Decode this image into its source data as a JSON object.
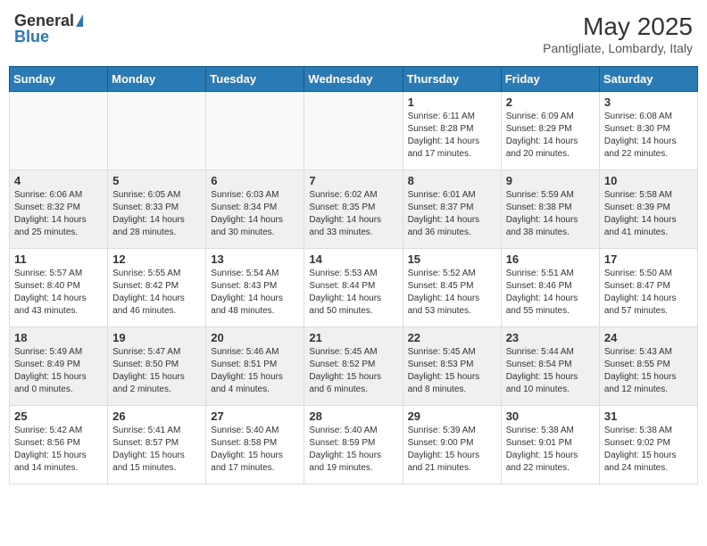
{
  "logo": {
    "general": "General",
    "blue": "Blue"
  },
  "title": "May 2025",
  "subtitle": "Pantigliate, Lombardy, Italy",
  "headers": [
    "Sunday",
    "Monday",
    "Tuesday",
    "Wednesday",
    "Thursday",
    "Friday",
    "Saturday"
  ],
  "weeks": [
    [
      {
        "day": "",
        "info": ""
      },
      {
        "day": "",
        "info": ""
      },
      {
        "day": "",
        "info": ""
      },
      {
        "day": "",
        "info": ""
      },
      {
        "day": "1",
        "info": "Sunrise: 6:11 AM\nSunset: 8:28 PM\nDaylight: 14 hours and 17 minutes."
      },
      {
        "day": "2",
        "info": "Sunrise: 6:09 AM\nSunset: 8:29 PM\nDaylight: 14 hours and 20 minutes."
      },
      {
        "day": "3",
        "info": "Sunrise: 6:08 AM\nSunset: 8:30 PM\nDaylight: 14 hours and 22 minutes."
      }
    ],
    [
      {
        "day": "4",
        "info": "Sunrise: 6:06 AM\nSunset: 8:32 PM\nDaylight: 14 hours and 25 minutes."
      },
      {
        "day": "5",
        "info": "Sunrise: 6:05 AM\nSunset: 8:33 PM\nDaylight: 14 hours and 28 minutes."
      },
      {
        "day": "6",
        "info": "Sunrise: 6:03 AM\nSunset: 8:34 PM\nDaylight: 14 hours and 30 minutes."
      },
      {
        "day": "7",
        "info": "Sunrise: 6:02 AM\nSunset: 8:35 PM\nDaylight: 14 hours and 33 minutes."
      },
      {
        "day": "8",
        "info": "Sunrise: 6:01 AM\nSunset: 8:37 PM\nDaylight: 14 hours and 36 minutes."
      },
      {
        "day": "9",
        "info": "Sunrise: 5:59 AM\nSunset: 8:38 PM\nDaylight: 14 hours and 38 minutes."
      },
      {
        "day": "10",
        "info": "Sunrise: 5:58 AM\nSunset: 8:39 PM\nDaylight: 14 hours and 41 minutes."
      }
    ],
    [
      {
        "day": "11",
        "info": "Sunrise: 5:57 AM\nSunset: 8:40 PM\nDaylight: 14 hours and 43 minutes."
      },
      {
        "day": "12",
        "info": "Sunrise: 5:55 AM\nSunset: 8:42 PM\nDaylight: 14 hours and 46 minutes."
      },
      {
        "day": "13",
        "info": "Sunrise: 5:54 AM\nSunset: 8:43 PM\nDaylight: 14 hours and 48 minutes."
      },
      {
        "day": "14",
        "info": "Sunrise: 5:53 AM\nSunset: 8:44 PM\nDaylight: 14 hours and 50 minutes."
      },
      {
        "day": "15",
        "info": "Sunrise: 5:52 AM\nSunset: 8:45 PM\nDaylight: 14 hours and 53 minutes."
      },
      {
        "day": "16",
        "info": "Sunrise: 5:51 AM\nSunset: 8:46 PM\nDaylight: 14 hours and 55 minutes."
      },
      {
        "day": "17",
        "info": "Sunrise: 5:50 AM\nSunset: 8:47 PM\nDaylight: 14 hours and 57 minutes."
      }
    ],
    [
      {
        "day": "18",
        "info": "Sunrise: 5:49 AM\nSunset: 8:49 PM\nDaylight: 15 hours and 0 minutes."
      },
      {
        "day": "19",
        "info": "Sunrise: 5:47 AM\nSunset: 8:50 PM\nDaylight: 15 hours and 2 minutes."
      },
      {
        "day": "20",
        "info": "Sunrise: 5:46 AM\nSunset: 8:51 PM\nDaylight: 15 hours and 4 minutes."
      },
      {
        "day": "21",
        "info": "Sunrise: 5:45 AM\nSunset: 8:52 PM\nDaylight: 15 hours and 6 minutes."
      },
      {
        "day": "22",
        "info": "Sunrise: 5:45 AM\nSunset: 8:53 PM\nDaylight: 15 hours and 8 minutes."
      },
      {
        "day": "23",
        "info": "Sunrise: 5:44 AM\nSunset: 8:54 PM\nDaylight: 15 hours and 10 minutes."
      },
      {
        "day": "24",
        "info": "Sunrise: 5:43 AM\nSunset: 8:55 PM\nDaylight: 15 hours and 12 minutes."
      }
    ],
    [
      {
        "day": "25",
        "info": "Sunrise: 5:42 AM\nSunset: 8:56 PM\nDaylight: 15 hours and 14 minutes."
      },
      {
        "day": "26",
        "info": "Sunrise: 5:41 AM\nSunset: 8:57 PM\nDaylight: 15 hours and 15 minutes."
      },
      {
        "day": "27",
        "info": "Sunrise: 5:40 AM\nSunset: 8:58 PM\nDaylight: 15 hours and 17 minutes."
      },
      {
        "day": "28",
        "info": "Sunrise: 5:40 AM\nSunset: 8:59 PM\nDaylight: 15 hours and 19 minutes."
      },
      {
        "day": "29",
        "info": "Sunrise: 5:39 AM\nSunset: 9:00 PM\nDaylight: 15 hours and 21 minutes."
      },
      {
        "day": "30",
        "info": "Sunrise: 5:38 AM\nSunset: 9:01 PM\nDaylight: 15 hours and 22 minutes."
      },
      {
        "day": "31",
        "info": "Sunrise: 5:38 AM\nSunset: 9:02 PM\nDaylight: 15 hours and 24 minutes."
      }
    ]
  ]
}
